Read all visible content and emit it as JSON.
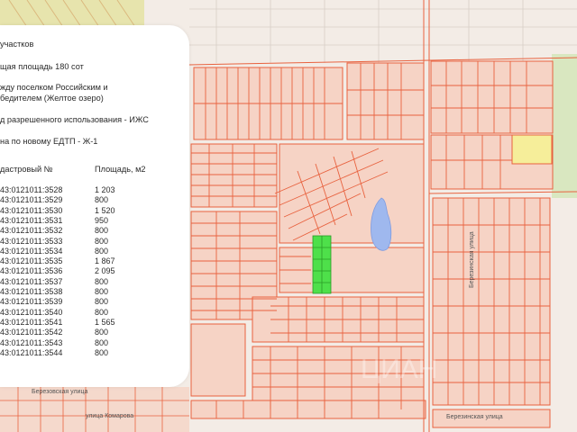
{
  "panel": {
    "lines": [
      "участков",
      "щая площадь 180 сот",
      "жду поселком Российским и",
      "бедителем (Желтое озеро)",
      "д разрешенного использования - ИЖС",
      "на по новому ЕДТП - Ж-1"
    ],
    "col_cadastral": "дастровый №",
    "col_area": "Площадь, м2",
    "rows": [
      {
        "id": "43:0121011:3528",
        "area": "1 203"
      },
      {
        "id": "43:0121011:3529",
        "area": "800"
      },
      {
        "id": "43:0121011:3530",
        "area": "1 520"
      },
      {
        "id": "43:0121011:3531",
        "area": "950"
      },
      {
        "id": "43:0121011:3532",
        "area": "800"
      },
      {
        "id": "43:0121011:3533",
        "area": "800"
      },
      {
        "id": "43:0121011:3534",
        "area": "800"
      },
      {
        "id": "43:0121011:3535",
        "area": "1 867"
      },
      {
        "id": "43:0121011:3536",
        "area": "2 095"
      },
      {
        "id": "43:0121011:3537",
        "area": "800"
      },
      {
        "id": "43:0121011:3538",
        "area": "800"
      },
      {
        "id": "43:0121011:3539",
        "area": "800"
      },
      {
        "id": "43:0121011:3540",
        "area": "800"
      },
      {
        "id": "43:0121011:3541",
        "area": "1 565"
      },
      {
        "id": "43:0121011:3542",
        "area": "800"
      },
      {
        "id": "43:0121011:3543",
        "area": "800"
      },
      {
        "id": "43:0121011:3544",
        "area": "800"
      }
    ]
  },
  "map": {
    "streets": [
      "Березовская улица",
      "улица Комарова",
      "Березинская улица",
      "Березинская улица"
    ],
    "colors": {
      "background": "#f3ece6",
      "parcel_fill": "#f6d3c5",
      "parcel_stroke": "#e8623f",
      "highlight_green": "#4ee04a",
      "water": "#9fb8ee",
      "yellow_parcel": "#f6ee9a",
      "green_area": "#d9e7c0"
    }
  }
}
